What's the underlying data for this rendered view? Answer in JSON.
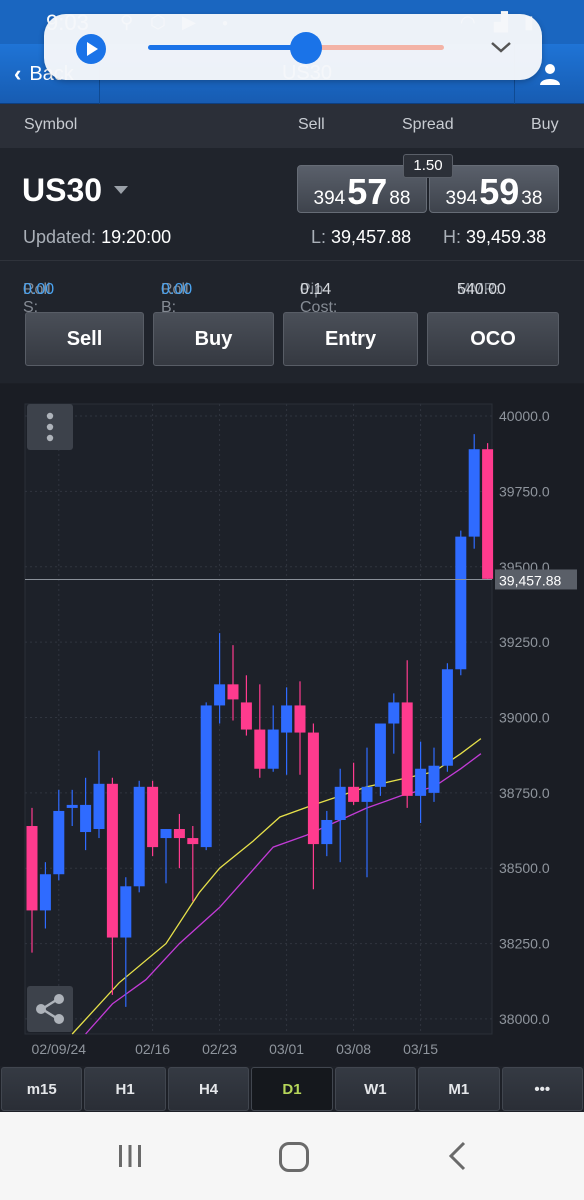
{
  "status_bar": {
    "time": "9:03"
  },
  "header": {
    "back_label": "Back",
    "title": "US30"
  },
  "columns": {
    "symbol": "Symbol",
    "sell": "Sell",
    "spread": "Spread",
    "buy": "Buy"
  },
  "instrument": {
    "symbol": "US30",
    "spread": "1.50",
    "sell": {
      "prefix": "394",
      "big": "57",
      "suffix": "88"
    },
    "buy": {
      "prefix": "394",
      "big": "59",
      "suffix": "38"
    },
    "updated_label": "Updated:",
    "updated_value": "19:20:00",
    "low_label": "L:",
    "low_value": "39,457.88",
    "high_label": "H:",
    "high_value": "39,459.38",
    "roll_s_label": "Roll S:",
    "roll_s_value": "0.00",
    "roll_b_label": "Roll B:",
    "roll_b_value": "0.00",
    "pip_cost_label": "Pip Cost:",
    "pip_cost_value": "0.14",
    "mmr_label": "MMR:",
    "mmr_value": "540.00"
  },
  "actions": {
    "sell": "Sell",
    "buy": "Buy",
    "entry": "Entry",
    "oco": "OCO"
  },
  "timeframes": [
    "m15",
    "H1",
    "H4",
    "D1",
    "W1",
    "M1",
    "•••"
  ],
  "active_timeframe": "D1",
  "colors": {
    "up": "#2f6bff",
    "down": "#ff3b8e",
    "ma_fast": "#e6e04a",
    "ma_slow": "#c23bd6",
    "accent": "#1a66c0"
  },
  "chart_data": {
    "type": "candlestick",
    "y_ticks": [
      "40000.0",
      "39750.0",
      "39500.0",
      "39250.0",
      "39000.0",
      "38750.0",
      "38500.0",
      "38250.0",
      "38000.0"
    ],
    "ylim": [
      37950,
      40040
    ],
    "x_ticks": [
      "02/09/24",
      "02/16",
      "02/23",
      "03/01",
      "03/08",
      "03/15"
    ],
    "current_price_label": "39,457.88",
    "current_price": 39457.88,
    "candles": [
      {
        "o": 38640,
        "h": 38700,
        "l": 38220,
        "c": 38360
      },
      {
        "o": 38360,
        "h": 38520,
        "l": 38300,
        "c": 38480
      },
      {
        "o": 38480,
        "h": 38760,
        "l": 38460,
        "c": 38690
      },
      {
        "o": 38700,
        "h": 38760,
        "l": 38640,
        "c": 38710
      },
      {
        "o": 38620,
        "h": 38800,
        "l": 38560,
        "c": 38710
      },
      {
        "o": 38630,
        "h": 38890,
        "l": 38600,
        "c": 38780
      },
      {
        "o": 38780,
        "h": 38800,
        "l": 38080,
        "c": 38270
      },
      {
        "o": 38270,
        "h": 38470,
        "l": 38040,
        "c": 38440
      },
      {
        "o": 38440,
        "h": 38790,
        "l": 38420,
        "c": 38770
      },
      {
        "o": 38770,
        "h": 38790,
        "l": 38540,
        "c": 38570
      },
      {
        "o": 38600,
        "h": 38630,
        "l": 38450,
        "c": 38630
      },
      {
        "o": 38630,
        "h": 38680,
        "l": 38500,
        "c": 38600
      },
      {
        "o": 38600,
        "h": 38640,
        "l": 38390,
        "c": 38580
      },
      {
        "o": 38570,
        "h": 39050,
        "l": 38560,
        "c": 39040
      },
      {
        "o": 39040,
        "h": 39280,
        "l": 38980,
        "c": 39110
      },
      {
        "o": 39110,
        "h": 39240,
        "l": 38990,
        "c": 39060
      },
      {
        "o": 39050,
        "h": 39140,
        "l": 38940,
        "c": 38960
      },
      {
        "o": 38960,
        "h": 39110,
        "l": 38800,
        "c": 38830
      },
      {
        "o": 38830,
        "h": 39040,
        "l": 38820,
        "c": 38960
      },
      {
        "o": 38950,
        "h": 39100,
        "l": 38810,
        "c": 39040
      },
      {
        "o": 39040,
        "h": 39120,
        "l": 38810,
        "c": 38950
      },
      {
        "o": 38950,
        "h": 38980,
        "l": 38430,
        "c": 38580
      },
      {
        "o": 38580,
        "h": 38690,
        "l": 38540,
        "c": 38660
      },
      {
        "o": 38660,
        "h": 38830,
        "l": 38520,
        "c": 38770
      },
      {
        "o": 38770,
        "h": 38850,
        "l": 38710,
        "c": 38720
      },
      {
        "o": 38720,
        "h": 38900,
        "l": 38470,
        "c": 38770
      },
      {
        "o": 38770,
        "h": 38960,
        "l": 38740,
        "c": 38980
      },
      {
        "o": 38980,
        "h": 39080,
        "l": 38880,
        "c": 39050
      },
      {
        "o": 39050,
        "h": 39190,
        "l": 38700,
        "c": 38740
      },
      {
        "o": 38740,
        "h": 38920,
        "l": 38650,
        "c": 38830
      },
      {
        "o": 38750,
        "h": 38900,
        "l": 38720,
        "c": 38840
      },
      {
        "o": 38840,
        "h": 39180,
        "l": 38820,
        "c": 39160
      },
      {
        "o": 39160,
        "h": 39620,
        "l": 39140,
        "c": 39600
      },
      {
        "o": 39600,
        "h": 39940,
        "l": 39560,
        "c": 39890
      },
      {
        "o": 39890,
        "h": 39910,
        "l": 39460,
        "c": 39460
      }
    ],
    "ma_fast": [
      {
        "i": 3.0,
        "v": 37950
      },
      {
        "i": 6.5,
        "v": 38120
      },
      {
        "i": 10.0,
        "v": 38250
      },
      {
        "i": 12.5,
        "v": 38420
      },
      {
        "i": 14.0,
        "v": 38500
      },
      {
        "i": 16.5,
        "v": 38590
      },
      {
        "i": 18.5,
        "v": 38670
      },
      {
        "i": 21.0,
        "v": 38710
      },
      {
        "i": 23.0,
        "v": 38740
      },
      {
        "i": 25.0,
        "v": 38770
      },
      {
        "i": 28.0,
        "v": 38800
      },
      {
        "i": 30.0,
        "v": 38820
      },
      {
        "i": 32.0,
        "v": 38880
      },
      {
        "i": 33.5,
        "v": 38930
      }
    ],
    "ma_slow": [
      {
        "i": 4.0,
        "v": 37950
      },
      {
        "i": 6.0,
        "v": 38050
      },
      {
        "i": 8.5,
        "v": 38130
      },
      {
        "i": 11.0,
        "v": 38250
      },
      {
        "i": 14.0,
        "v": 38370
      },
      {
        "i": 16.0,
        "v": 38470
      },
      {
        "i": 18.0,
        "v": 38570
      },
      {
        "i": 20.5,
        "v": 38610
      },
      {
        "i": 22.5,
        "v": 38650
      },
      {
        "i": 25.0,
        "v": 38700
      },
      {
        "i": 27.5,
        "v": 38740
      },
      {
        "i": 30.0,
        "v": 38770
      },
      {
        "i": 32.0,
        "v": 38830
      },
      {
        "i": 33.5,
        "v": 38880
      }
    ]
  }
}
